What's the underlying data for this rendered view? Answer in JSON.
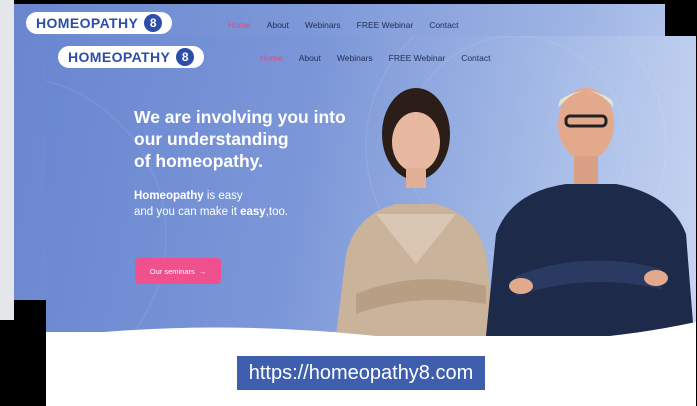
{
  "brand": {
    "name": "HOMEOPATHY",
    "mark": "8"
  },
  "nav": {
    "items": [
      {
        "label": "Home",
        "active": true
      },
      {
        "label": "About",
        "active": false
      },
      {
        "label": "Webinars",
        "active": false
      },
      {
        "label": "FREE Webinar",
        "active": false
      },
      {
        "label": "Contact",
        "active": false
      }
    ]
  },
  "hero": {
    "headline_lines": [
      "We are involving you into",
      "our understanding",
      "of homeopathy."
    ],
    "sub1_bold": "Homeopathy",
    "sub1_rest": " is easy",
    "sub2_pre": "and you can make it ",
    "sub2_bold": "easy",
    "sub2_post": ",too.",
    "cta_label": "Our seminars",
    "cta_icon": "arrow-right-icon"
  },
  "caption": {
    "url": "https://homeopathy8.com"
  },
  "colors": {
    "accent": "#f0518e",
    "brand": "#2c4ea8",
    "hero": "#7c97d8"
  }
}
